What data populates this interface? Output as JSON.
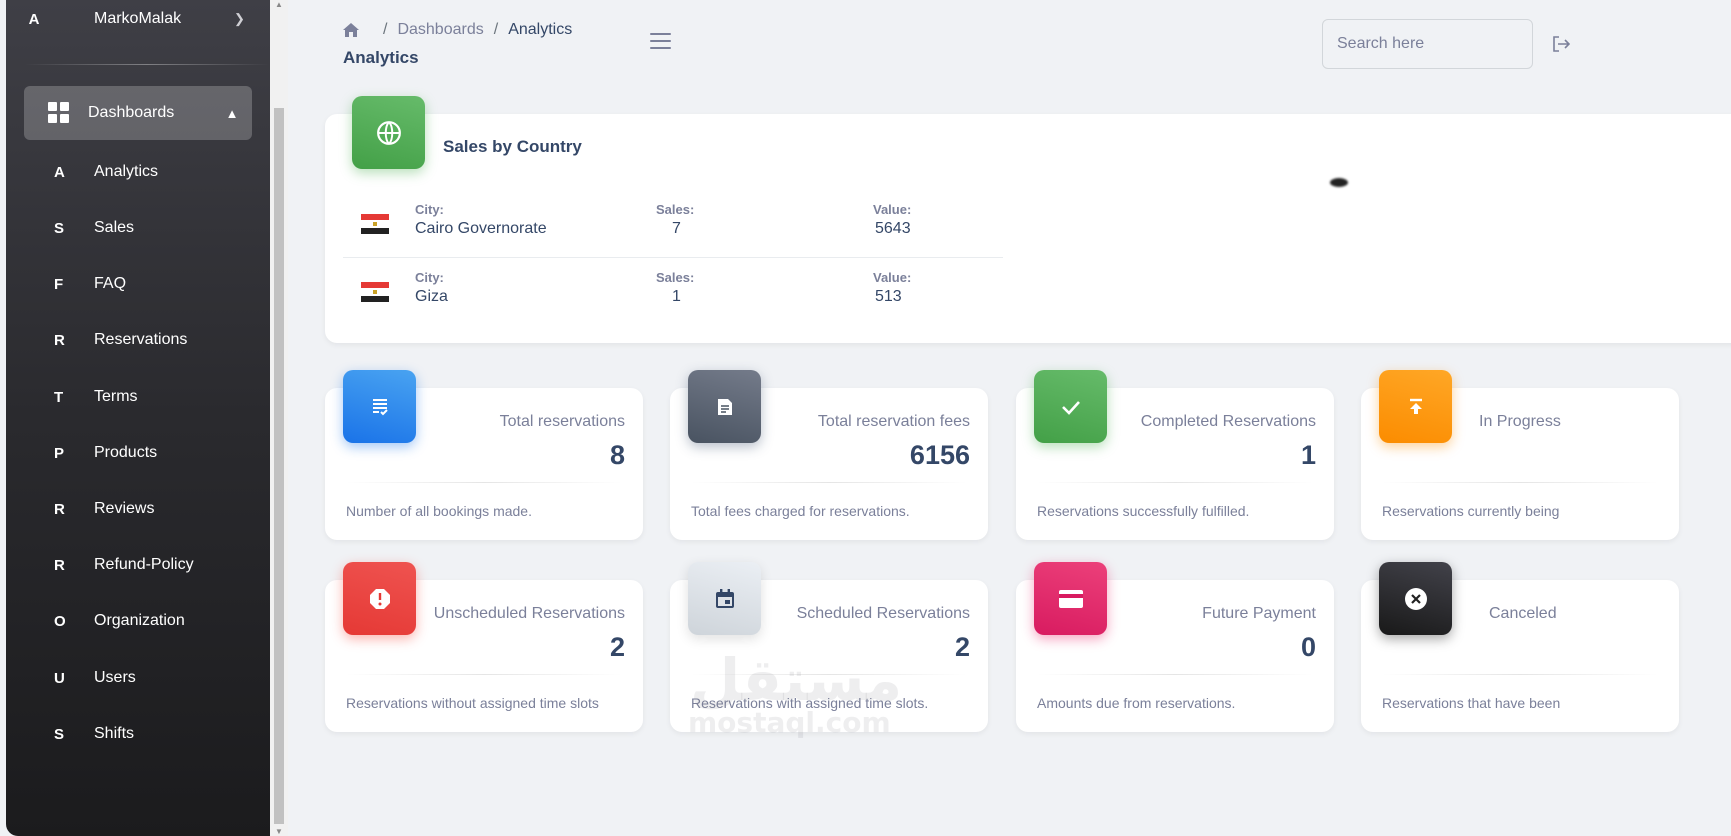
{
  "sidebar": {
    "user": {
      "initial": "A",
      "name": "MarkoMalak"
    },
    "dashboards_label": "Dashboards",
    "items": [
      {
        "letter": "A",
        "label": "Analytics"
      },
      {
        "letter": "S",
        "label": "Sales"
      },
      {
        "letter": "F",
        "label": "FAQ"
      },
      {
        "letter": "R",
        "label": "Reservations"
      },
      {
        "letter": "T",
        "label": "Terms"
      },
      {
        "letter": "P",
        "label": "Products"
      },
      {
        "letter": "R",
        "label": "Reviews"
      },
      {
        "letter": "R",
        "label": "Refund-Policy"
      },
      {
        "letter": "O",
        "label": "Organization"
      },
      {
        "letter": "U",
        "label": "Users"
      },
      {
        "letter": "S",
        "label": "Shifts"
      }
    ]
  },
  "header": {
    "breadcrumb": [
      "Dashboards",
      "Analytics"
    ],
    "title": "Analytics",
    "search_placeholder": "Search here"
  },
  "sales": {
    "title": "Sales by Country",
    "labels": {
      "city": "City:",
      "sales": "Sales:",
      "value": "Value:"
    },
    "rows": [
      {
        "city": "Cairo Governorate",
        "sales": "7",
        "value": "5643"
      },
      {
        "city": "Giza",
        "sales": "1",
        "value": "513"
      }
    ]
  },
  "stats": [
    {
      "title": "Total reservations",
      "value": "8",
      "desc": "Number of all bookings made.",
      "icon": "receipt-icon",
      "color": "#1a73e8"
    },
    {
      "title": "Total reservation fees",
      "value": "6156",
      "desc": "Total fees charged for reservations.",
      "icon": "document-icon",
      "color": "#495361"
    },
    {
      "title": "Completed Reservations",
      "value": "1",
      "desc": "Reservations successfully fulfilled.",
      "icon": "check-icon",
      "color": "#43a047"
    },
    {
      "title": "In Progress",
      "value": "",
      "desc": "Reservations currently being",
      "icon": "upload-icon",
      "color": "#fb8c00"
    },
    {
      "title": "Unscheduled Reservations",
      "value": "2",
      "desc": "Reservations without assigned time slots",
      "icon": "alert-icon",
      "color": "#e53935"
    },
    {
      "title": "Scheduled Reservations",
      "value": "2",
      "desc": "Reservations with assigned time slots.",
      "icon": "calendar-icon",
      "color": "#ced4da"
    },
    {
      "title": "Future Payment",
      "value": "0",
      "desc": "Amounts due from reservations.",
      "icon": "card-icon",
      "color": "#d81b60"
    },
    {
      "title": "Canceled",
      "value": "",
      "desc": "Reservations that have been",
      "icon": "cancel-icon",
      "color": "#191919"
    }
  ],
  "watermark": {
    "arabic": "مستقل",
    "latin": "mostaql.com"
  }
}
